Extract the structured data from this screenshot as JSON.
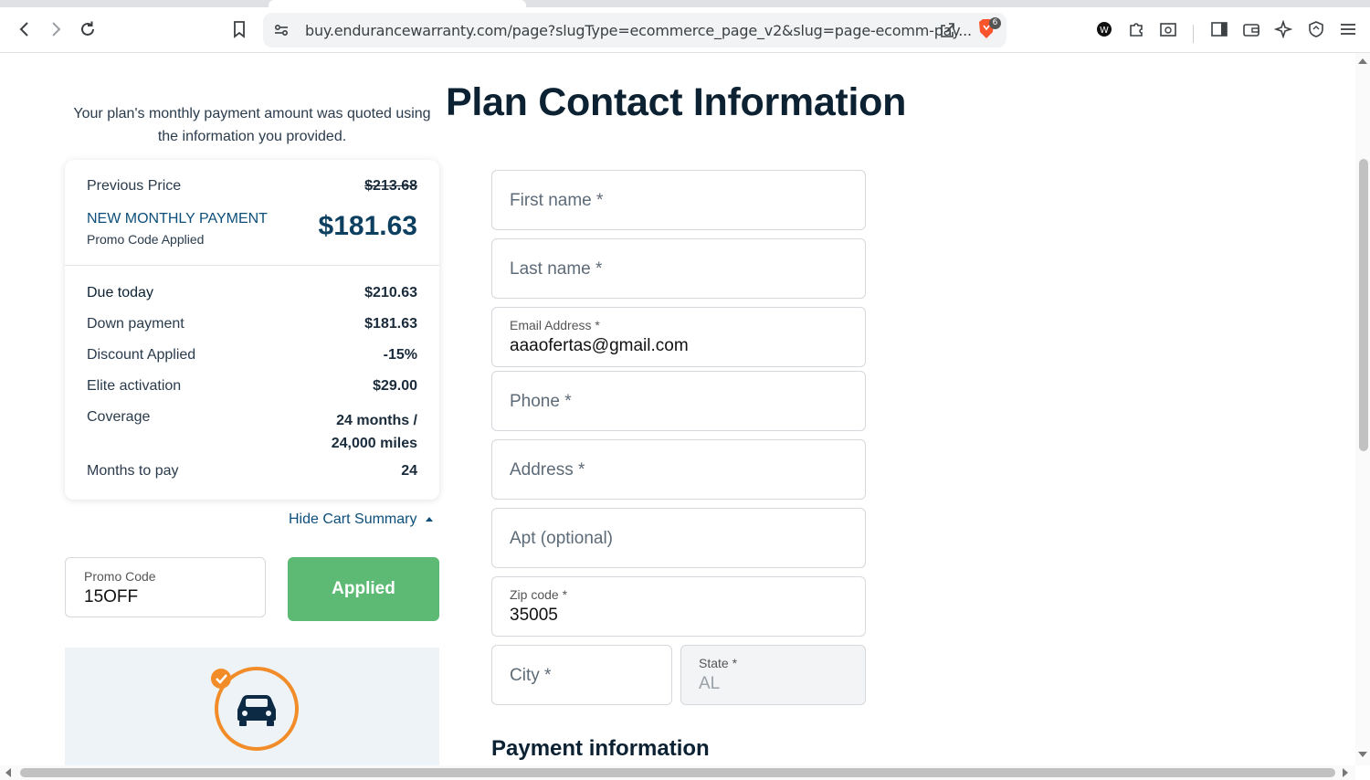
{
  "browser": {
    "url": "buy.endurancewarranty.com/page?slugType=ecommerce_page_v2&slug=page-ecomm-pay...",
    "shield_count": "6"
  },
  "header": {
    "intro_text": "Your plan's monthly payment amount was quoted using the information you provided.",
    "title": "Plan Contact Information"
  },
  "cart": {
    "previous_price_label": "Previous Price",
    "previous_price": "$213.68",
    "new_payment_label": "NEW MONTHLY PAYMENT",
    "promo_applied_label": "Promo Code Applied",
    "new_payment_value": "$181.63",
    "rows": [
      {
        "label": "Due today",
        "value": "$210.63"
      },
      {
        "label": "Down payment",
        "value": "$181.63"
      },
      {
        "label": "Discount Applied",
        "value": "-15%"
      },
      {
        "label": "Elite activation",
        "value": "$29.00"
      },
      {
        "label": "Coverage",
        "value_line1": "24 months /",
        "value_line2": "24,000 miles"
      },
      {
        "label": "Months to pay",
        "value": "24"
      }
    ],
    "hide_label": "Hide Cart Summary"
  },
  "promo": {
    "label": "Promo Code",
    "value": "15OFF",
    "button_label": "Applied"
  },
  "form": {
    "first_name_placeholder": "First name *",
    "last_name_placeholder": "Last name *",
    "email_label": "Email Address *",
    "email_value": "aaaofertas@gmail.com",
    "phone_placeholder": "Phone *",
    "address_placeholder": "Address *",
    "apt_placeholder": "Apt (optional)",
    "zip_label": "Zip code *",
    "zip_value": "35005",
    "city_placeholder": "City *",
    "state_label": "State *",
    "state_value": "AL"
  },
  "payment": {
    "title": "Payment information"
  },
  "colors": {
    "accent_blue": "#0d4f7a",
    "applied_green": "#5cba74",
    "discount_green": "#35a853",
    "strike_red": "#d9534f",
    "car_orange": "#f28c28"
  }
}
